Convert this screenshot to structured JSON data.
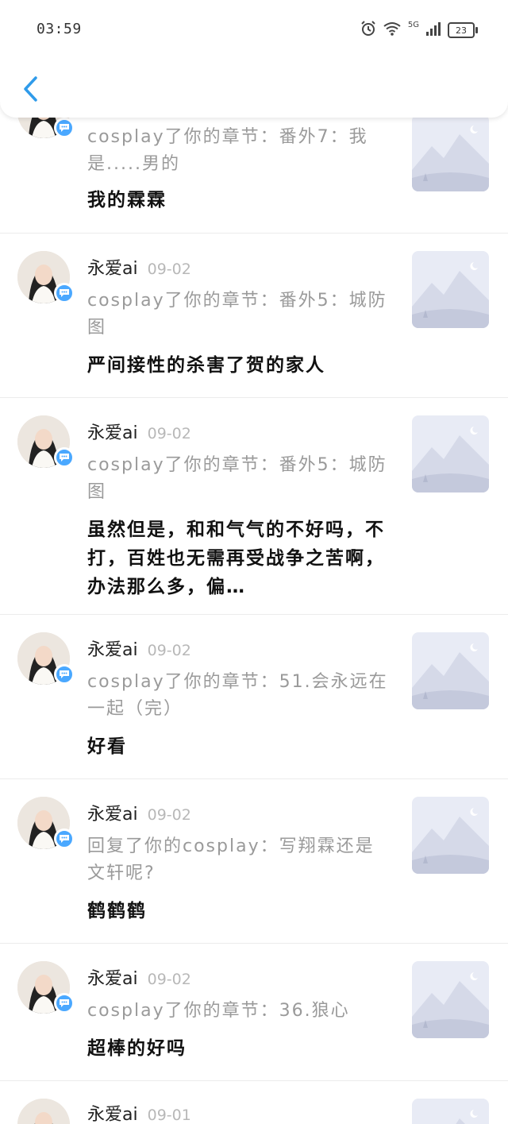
{
  "status_bar": {
    "time": "03:59",
    "network": "5G",
    "battery": "23"
  },
  "header": {
    "back_icon": "chevron-left-icon",
    "accent_color": "#2f9bea"
  },
  "notifications": [
    {
      "name": "",
      "date": "",
      "summary": "cosplay了你的章节：番外7：我是.....男的",
      "comment": "我的霖霖"
    },
    {
      "name": "永爱ai",
      "date": "09-02",
      "summary": "cosplay了你的章节：番外5：城防图",
      "comment": "严间接性的杀害了贺的家人"
    },
    {
      "name": "永爱ai",
      "date": "09-02",
      "summary": "cosplay了你的章节：番外5：城防图",
      "comment": "虽然但是，和和气气的不好吗，不打，百姓也无需再受战争之苦啊，办法那么多，偏…"
    },
    {
      "name": "永爱ai",
      "date": "09-02",
      "summary": "cosplay了你的章节：51.会永远在一起（完）",
      "comment": "好看"
    },
    {
      "name": "永爱ai",
      "date": "09-02",
      "summary": "回复了你的cosplay：写翔霖还是文轩呢?",
      "comment": "鹤鹤鹤"
    },
    {
      "name": "永爱ai",
      "date": "09-02",
      "summary": "cosplay了你的章节：36.狼心",
      "comment": "超棒的好吗"
    },
    {
      "name": "永爱ai",
      "date": "09-01",
      "summary": "",
      "comment": ""
    }
  ]
}
